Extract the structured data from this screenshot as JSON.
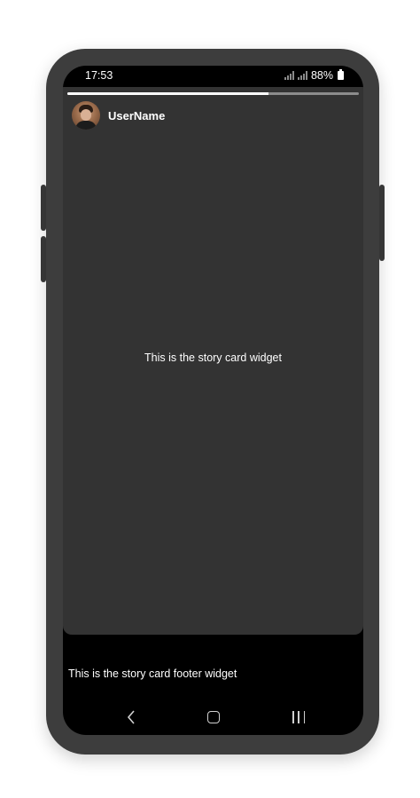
{
  "status_bar": {
    "time": "17:53",
    "battery": "88%"
  },
  "story": {
    "progress": 0.69,
    "username": "UserName",
    "body_text": "This is the story card widget"
  },
  "footer": {
    "text": "This is the story card footer widget"
  },
  "nav": {
    "back": "back-icon",
    "home": "home-icon",
    "recents": "recents-icon"
  }
}
